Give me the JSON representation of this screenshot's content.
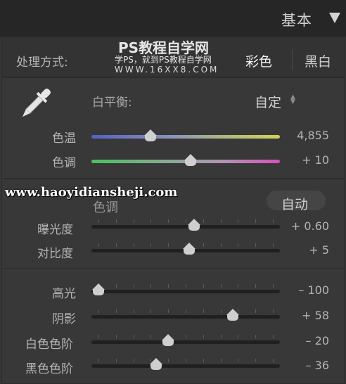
{
  "header": {
    "title": "基本",
    "collapse_icon": "triangle-down-icon"
  },
  "treatment": {
    "label": "处理方式:",
    "color": "彩色",
    "bw": "黑白"
  },
  "white_balance": {
    "label": "白平衡:",
    "value": "自定",
    "eyedropper_icon": "eyedropper-icon",
    "updown_icon": "updown-arrows-icon"
  },
  "sliders": {
    "temp": {
      "label": "色温",
      "value": "4,855",
      "position": 0.3
    },
    "tint": {
      "label": "色调",
      "value": "+ 10",
      "position": 0.53
    },
    "exposure": {
      "label": "曝光度",
      "value": "+ 0.60",
      "position": 0.55
    },
    "contrast": {
      "label": "对比度",
      "value": "+ 5",
      "position": 0.52
    },
    "highlights": {
      "label": "高光",
      "value": "– 100",
      "position": 0.0
    },
    "shadows": {
      "label": "阴影",
      "value": "+ 58",
      "position": 0.77
    },
    "whites": {
      "label": "白色色阶",
      "value": "– 20",
      "position": 0.4
    },
    "blacks": {
      "label": "黑色色阶",
      "value": "– 36",
      "position": 0.33
    }
  },
  "tone": {
    "label": "色调",
    "auto": "自动"
  },
  "watermark": {
    "title": "PS教程自学网",
    "subtitle": "学PS，就到PS教程自学网",
    "url": "WWW.16XX8.COM",
    "site": "www.haoyidiansheji.com"
  },
  "colors": {
    "background": "#373737",
    "header": "#262626",
    "text": "#b4b4b4"
  }
}
